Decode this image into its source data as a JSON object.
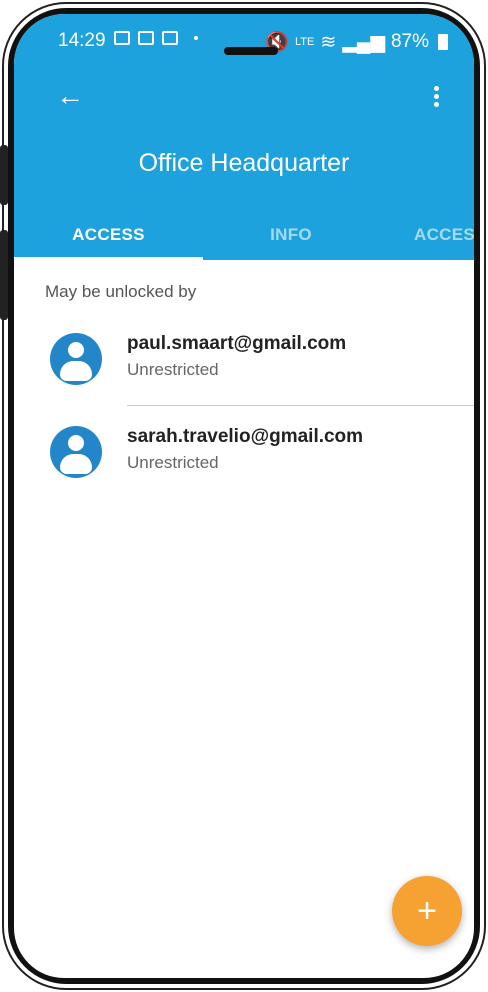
{
  "status_bar": {
    "time": "14:29",
    "network_label": "LTE",
    "battery": "87%"
  },
  "header": {
    "title": "Office Headquarter",
    "back_icon": "arrow-left-icon",
    "menu_icon": "more-vert-icon"
  },
  "tabs": [
    {
      "label": "ACCESS",
      "active": true
    },
    {
      "label": "INFO",
      "active": false
    },
    {
      "label": "ACCESS",
      "active": false
    }
  ],
  "section": {
    "label": "May be unlocked by"
  },
  "users": [
    {
      "email": "paul.smaart@gmail.com",
      "status": "Unrestricted"
    },
    {
      "email": "sarah.travelio@gmail.com",
      "status": "Unrestricted"
    }
  ],
  "fab": {
    "label": "+"
  },
  "colors": {
    "primary": "#1ea2dd",
    "avatar": "#2386c8",
    "fab": "#f6a233"
  }
}
